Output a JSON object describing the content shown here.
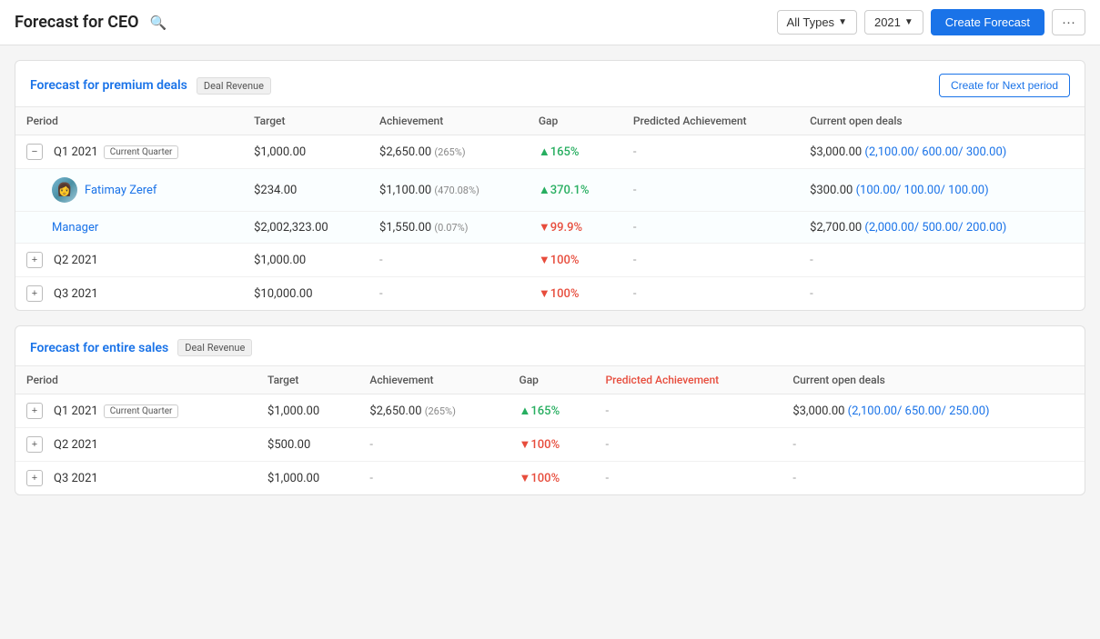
{
  "header": {
    "title": "Forecast for CEO",
    "search_icon": "🔍",
    "filters": {
      "type_label": "All Types",
      "year_label": "2021"
    },
    "create_forecast_label": "Create Forecast",
    "more_label": "···"
  },
  "forecasts": [
    {
      "id": "premium",
      "title": "Forecast for premium deals",
      "badge": "Deal Revenue",
      "create_next_label": "Create for Next period",
      "columns": [
        "Period",
        "Target",
        "Achievement",
        "Gap",
        "Predicted Achievement",
        "Current open deals"
      ],
      "rows": [
        {
          "type": "expandable",
          "expanded": true,
          "period": "Q1 2021",
          "current_quarter": true,
          "target": "$1,000.00",
          "achievement": "$2,650.00",
          "achievement_pct": "(265%)",
          "gap": "▲165%",
          "gap_type": "green",
          "predicted": "-",
          "open_deals": "$3,000.00",
          "open_deals_sub": "(2,100.00/ 600.00/ 300.00)",
          "sub_rows": [
            {
              "type": "person",
              "name": "Fatimay Zeref",
              "target": "$234.00",
              "achievement": "$1,100.00",
              "achievement_pct": "(470.08%)",
              "gap": "▲370.1%",
              "gap_type": "green",
              "predicted": "-",
              "open_deals": "$300.00",
              "open_deals_sub": "(100.00/ 100.00/ 100.00)"
            },
            {
              "type": "person",
              "name": "Manager",
              "target": "$2,002,323.00",
              "achievement": "$1,550.00",
              "achievement_pct": "(0.07%)",
              "gap": "▼99.9%",
              "gap_type": "red",
              "predicted": "-",
              "open_deals": "$2,700.00",
              "open_deals_sub": "(2,000.00/ 500.00/ 200.00)"
            }
          ]
        },
        {
          "type": "expandable",
          "expanded": false,
          "period": "Q2 2021",
          "current_quarter": false,
          "target": "$1,000.00",
          "achievement": "-",
          "achievement_pct": "",
          "gap": "▼100%",
          "gap_type": "red",
          "predicted": "-",
          "open_deals": "-",
          "open_deals_sub": ""
        },
        {
          "type": "expandable",
          "expanded": false,
          "period": "Q3 2021",
          "current_quarter": false,
          "target": "$10,000.00",
          "achievement": "-",
          "achievement_pct": "",
          "gap": "▼100%",
          "gap_type": "red",
          "predicted": "-",
          "open_deals": "-",
          "open_deals_sub": ""
        }
      ]
    },
    {
      "id": "entire",
      "title": "Forecast for entire sales",
      "badge": "Deal Revenue",
      "create_next_label": null,
      "columns": [
        "Period",
        "Target",
        "Achievement",
        "Gap",
        "Predicted Achievement",
        "Current open deals"
      ],
      "rows": [
        {
          "type": "expandable",
          "expanded": false,
          "period": "Q1 2021",
          "current_quarter": true,
          "target": "$1,000.00",
          "achievement": "$2,650.00",
          "achievement_pct": "(265%)",
          "gap": "▲165%",
          "gap_type": "green",
          "predicted": "-",
          "open_deals": "$3,000.00",
          "open_deals_sub": "(2,100.00/ 650.00/ 250.00)",
          "predicted_color": "red"
        },
        {
          "type": "expandable",
          "expanded": false,
          "period": "Q2 2021",
          "current_quarter": false,
          "target": "$500.00",
          "achievement": "-",
          "achievement_pct": "",
          "gap": "▼100%",
          "gap_type": "red",
          "predicted": "-",
          "open_deals": "-",
          "open_deals_sub": ""
        },
        {
          "type": "expandable",
          "expanded": false,
          "period": "Q3 2021",
          "current_quarter": false,
          "target": "$1,000.00",
          "achievement": "-",
          "achievement_pct": "",
          "gap": "▼100%",
          "gap_type": "red",
          "predicted": "-",
          "open_deals": "-",
          "open_deals_sub": ""
        }
      ]
    }
  ]
}
